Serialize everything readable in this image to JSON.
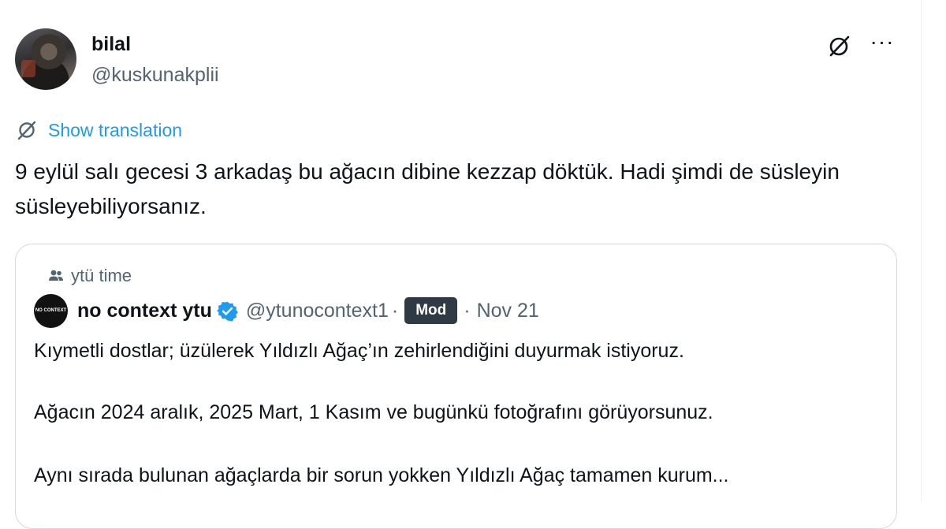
{
  "tweet": {
    "author": {
      "display_name": "bilal",
      "handle": "@kuskunakplii"
    },
    "translate_label": "Show translation",
    "text": "9 eylül salı gecesi 3 arkadaş bu ağacın dibine kezzap döktük. Hadi şimdi de süsleyin süsleyebiliyorsanız.",
    "more_label": "···"
  },
  "quote": {
    "community": "ytü time",
    "author": {
      "display_name": "no context ytu",
      "handle": "@ytunocontext1",
      "badge": "Mod",
      "separator": "·",
      "time": "Nov 21",
      "avatar_text": "NO CONTEXT"
    },
    "paragraphs": [
      "Kıymetli dostlar; üzülerek Yıldızlı Ağaç’ın zehirlendiğini duyurmak istiyoruz.",
      "Ağacın 2024 aralık, 2025 Mart, 1 Kasım ve bugünkü fotoğrafını görüyorsunuz.",
      "Aynı sırada bulunan ağaçlarda bir sorun yokken Yıldızlı Ağaç tamamen kurum..."
    ]
  },
  "icons": {
    "grok": "grok-icon",
    "translate": "translate-icon",
    "community": "people-icon",
    "verified": "verified-badge-icon",
    "more": "more-icon"
  },
  "colors": {
    "link": "#1d9bf0",
    "secondary_text": "#536471",
    "primary_text": "#0f1419",
    "border": "#cfd9de",
    "mod_badge": "#2f3b44"
  }
}
